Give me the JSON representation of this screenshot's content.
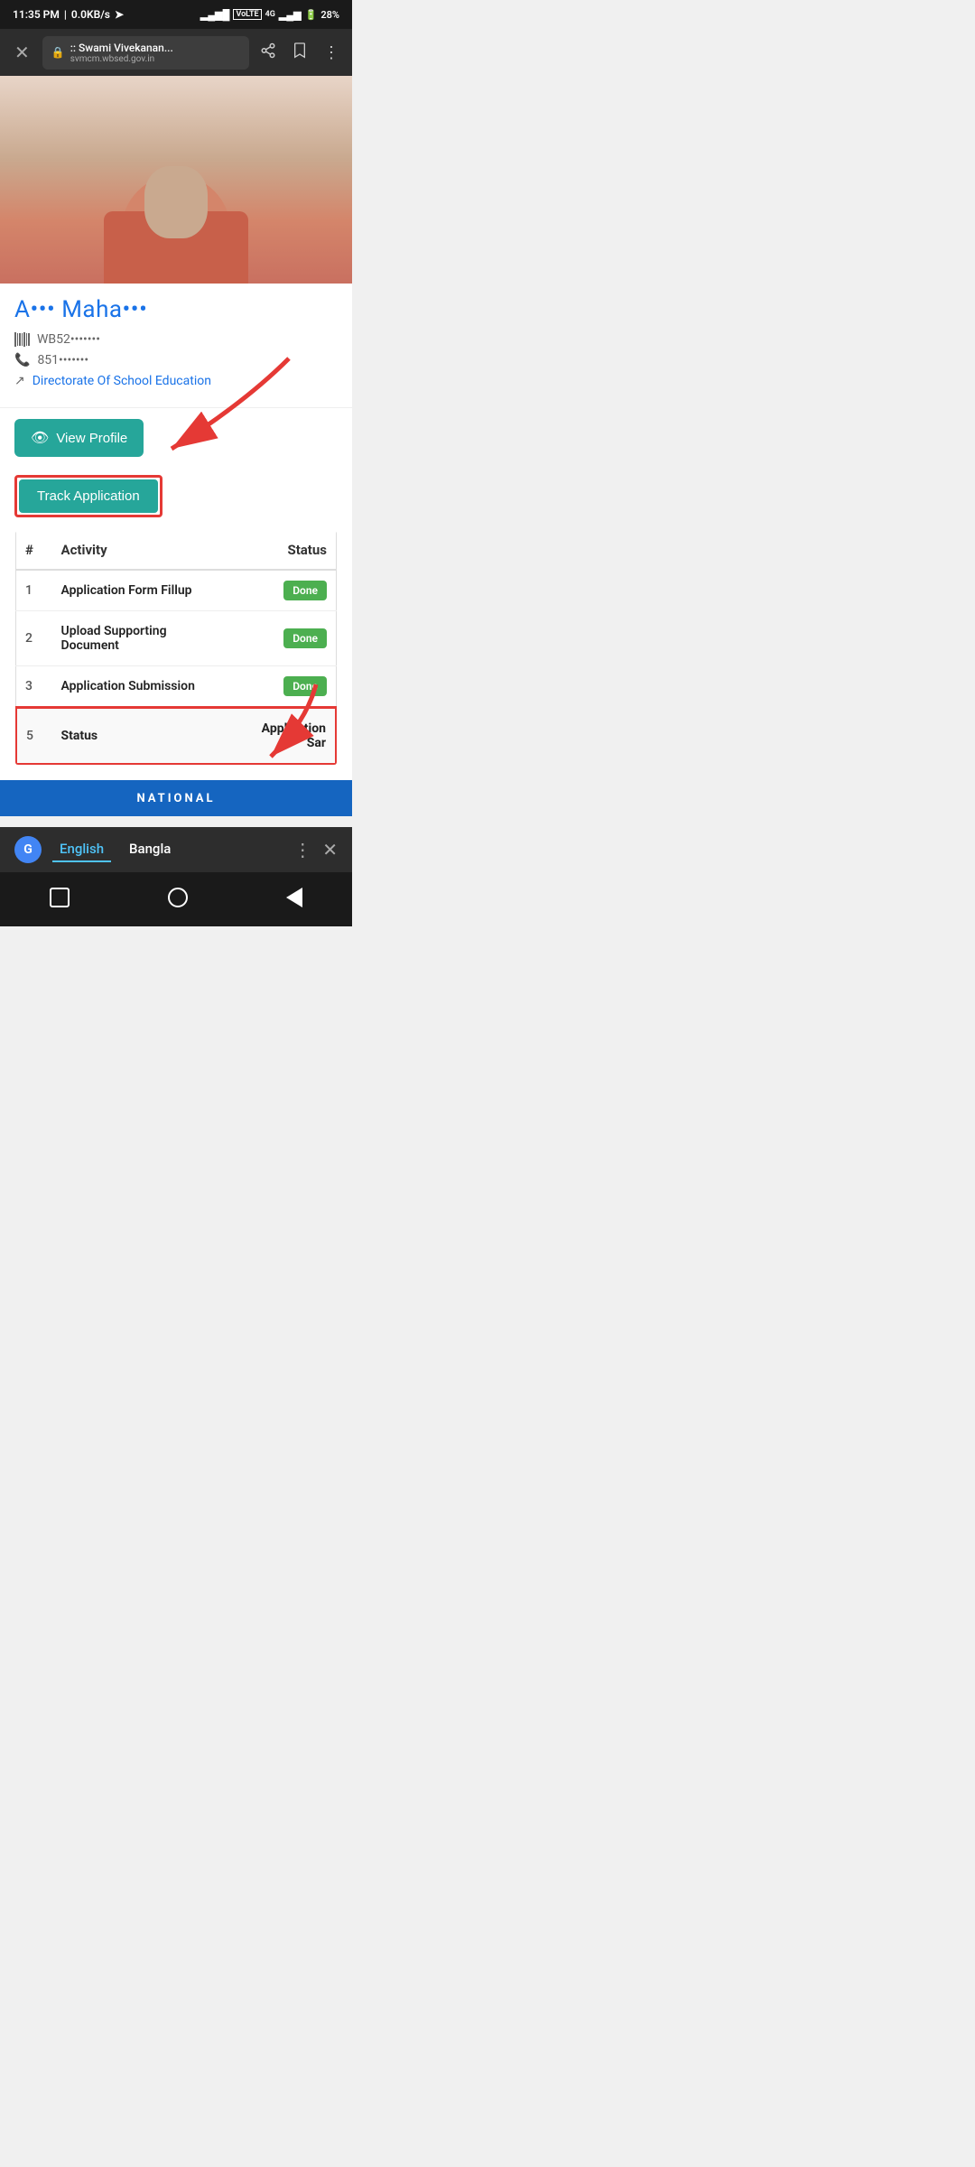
{
  "statusBar": {
    "time": "11:35 PM",
    "network": "0.0KB/s",
    "battery": "28%"
  },
  "browserBar": {
    "title": ":: Swami Vivekanan...",
    "domain": "svmcm.wbsed.gov.in"
  },
  "profile": {
    "name": "A••• Maha•••",
    "barcode": "WB52•••••••",
    "phone": "851•••••••",
    "organization": "Directorate Of School Education"
  },
  "buttons": {
    "viewProfile": "View Profile",
    "trackApplication": "Track Application"
  },
  "table": {
    "headers": {
      "num": "#",
      "activity": "Activity",
      "status": "Status"
    },
    "rows": [
      {
        "num": "1",
        "activity": "Application Form Fillup",
        "status": "Done",
        "statusType": "badge-done",
        "highlighted": false
      },
      {
        "num": "2",
        "activity": "Upload Supporting Document",
        "status": "Done",
        "statusType": "badge-done",
        "highlighted": false
      },
      {
        "num": "3",
        "activity": "Application Submission",
        "status": "Done",
        "statusType": "badge-done",
        "highlighted": false
      },
      {
        "num": "5",
        "activity": "Status",
        "status": "Application Sar",
        "statusType": "text",
        "highlighted": true
      }
    ]
  },
  "nationalBanner": "NATIONAL",
  "translator": {
    "english": "English",
    "bangla": "Bangla"
  }
}
